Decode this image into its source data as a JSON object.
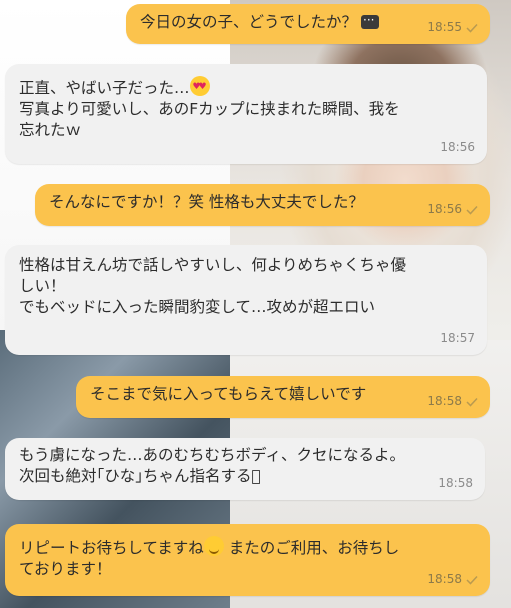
{
  "messages": [
    {
      "dir": "out",
      "text": "今日の女の子、どうでしたか？",
      "time": "18:55",
      "icon": "chat-bubble-icon"
    },
    {
      "dir": "in",
      "line1": "正直、やばい子だった…",
      "line1_emoji": "heart-eyes-emoji",
      "text": "写真より可愛いし、あのFカップに挟まれた瞬間、我を\n忘れたｗ",
      "time": "18:56"
    },
    {
      "dir": "out",
      "text": "そんなにですか！？笑 性格も大丈夫でした？",
      "time": "18:56"
    },
    {
      "dir": "in",
      "text": "性格は甘えん坊で話しやすいし、何よりめちゃくちゃ優\nしい！\nでもベッドに入った瞬間豹変して…攻めが超エロい",
      "time": "18:57"
    },
    {
      "dir": "out",
      "text": "そこまで気に入ってもらえて嬉しいです",
      "time": "18:58"
    },
    {
      "dir": "in",
      "text": "もう虜になった…あのむちむちボディ、クセになるよ。\n次回も絶対｢ひな｣ちゃん指名する􏿾",
      "time": "18:58"
    },
    {
      "dir": "out",
      "text_a": "リピートお待ちしてますね",
      "text_b": " またのご利用、お待ちし\nております！",
      "emoji": "smiling-blush-emoji",
      "time": "18:58"
    }
  ],
  "colors": {
    "outgoing": "#fbc34d",
    "incoming": "#f1f1f1"
  }
}
